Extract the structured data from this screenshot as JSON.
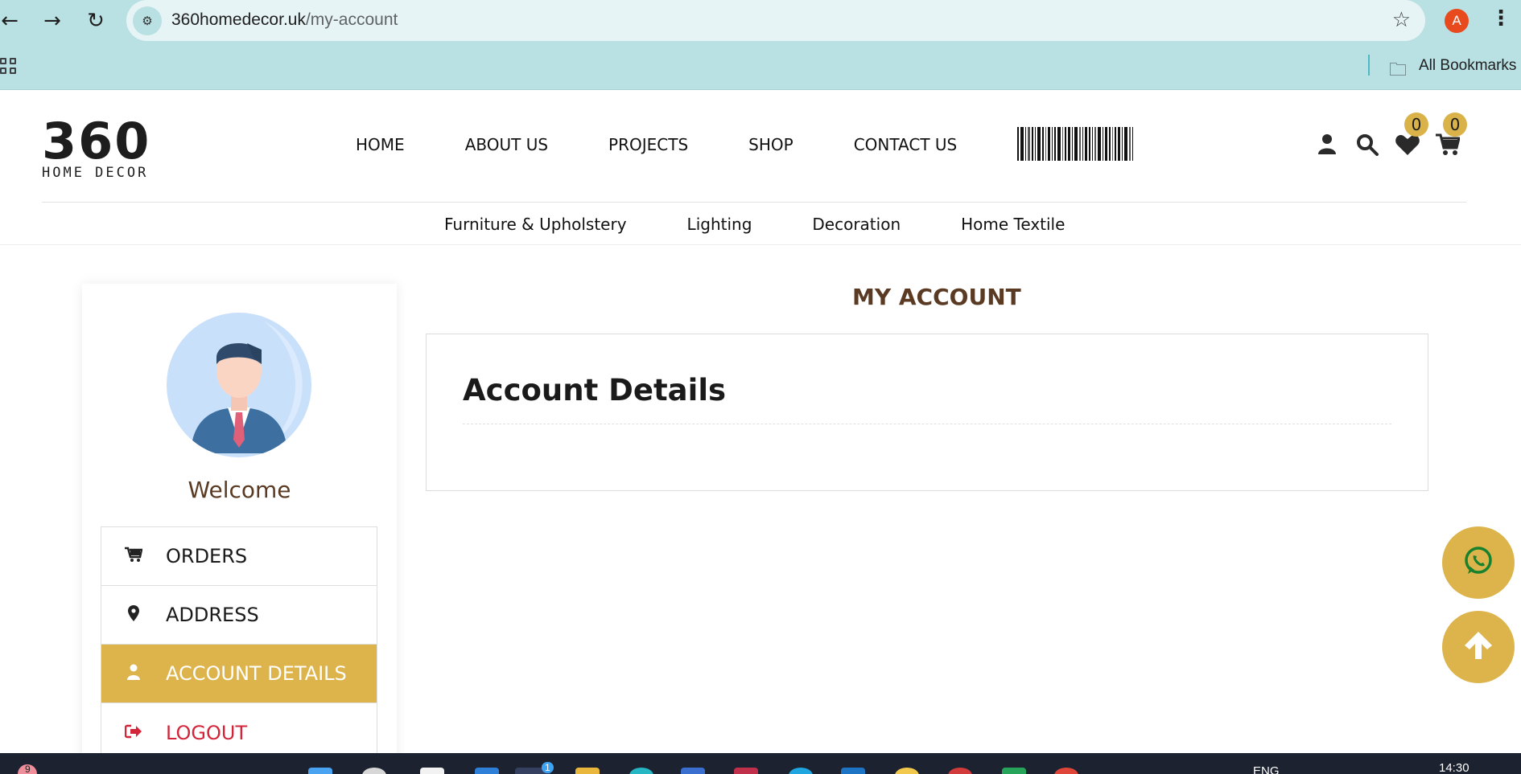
{
  "browser": {
    "url_domain": "360homedecor.uk",
    "url_path": "/my-account",
    "profile_initial": "A",
    "bookmarks_label": "All Bookmarks"
  },
  "header": {
    "logo_number": "360",
    "logo_text": "HOME DECOR",
    "nav": [
      "HOME",
      "ABOUT US",
      "PROJECTS",
      "SHOP",
      "CONTACT US"
    ],
    "wishlist_count": "0",
    "cart_count": "0"
  },
  "subnav": [
    "Furniture & Upholstery",
    "Lighting",
    "Decoration",
    "Home Textile"
  ],
  "sidebar": {
    "welcome": "Welcome",
    "menu": [
      {
        "label": "ORDERS",
        "icon": "cart-icon"
      },
      {
        "label": "ADDRESS",
        "icon": "map-marker-icon"
      },
      {
        "label": "ACCOUNT DETAILS",
        "icon": "user-icon",
        "active": true
      },
      {
        "label": "LOGOUT",
        "icon": "logout-icon"
      }
    ]
  },
  "main": {
    "heading": "MY ACCOUNT",
    "section_title": "Account Details"
  },
  "taskbar": {
    "lang": "ENG",
    "time": "14:30",
    "notification_count": "9",
    "app_badge": "1"
  },
  "colors": {
    "accent": "#ddb44b",
    "heading_brown": "#5a3a22",
    "logout_red": "#d3243a",
    "chrome": "#b9e0e3"
  }
}
